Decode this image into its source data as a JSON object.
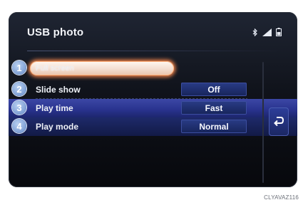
{
  "screen": {
    "title": "USB photo",
    "status_icons": [
      "bluetooth-icon",
      "signal-strength-icon",
      "battery-icon"
    ]
  },
  "menu": {
    "items": [
      {
        "number": "1",
        "label": "Full screen",
        "value": ""
      },
      {
        "number": "2",
        "label": "Slide show",
        "value": "Off"
      },
      {
        "number": "3",
        "label": "Play time",
        "value": "Fast"
      },
      {
        "number": "4",
        "label": "Play mode",
        "value": "Normal"
      }
    ]
  },
  "back_button": {
    "icon": "return-arrow-icon"
  },
  "caption": "CLYAVAZ116",
  "colors": {
    "screen_bg": "#10131b",
    "highlight_glow": "#ff8a4c",
    "selected_band": "#2a3490",
    "value_box": "#1f2f72"
  }
}
